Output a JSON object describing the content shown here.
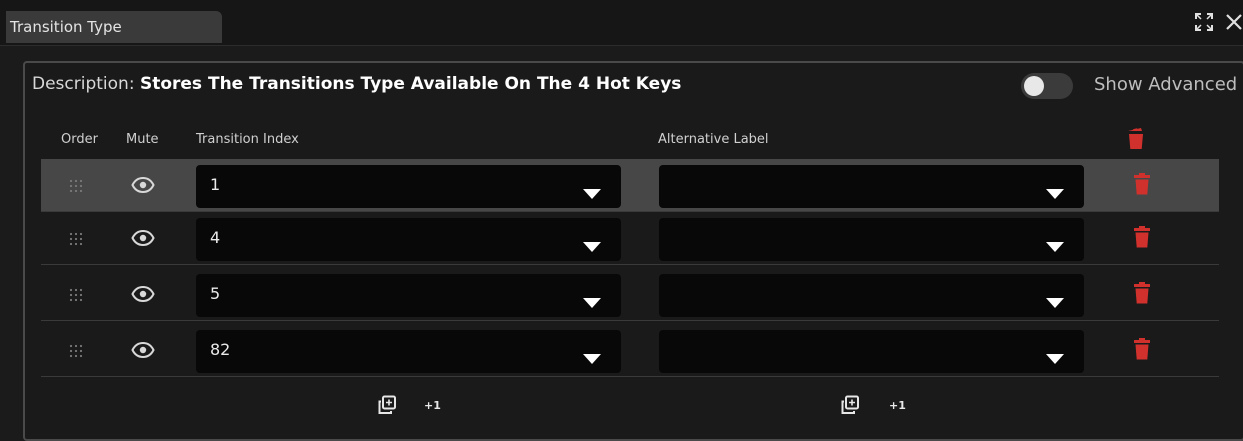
{
  "window": {
    "tab_title": "Transition Type"
  },
  "panel": {
    "description_label": "Description:",
    "description_text": "Stores The Transitions Type Available On The 4 Hot Keys",
    "show_advanced_label": "Show Advanced",
    "show_advanced_on": false
  },
  "columns": {
    "order": "Order",
    "mute": "Mute",
    "transition_index": "Transition Index",
    "alternative_label": "Alternative Label"
  },
  "rows": [
    {
      "transition_index": "1",
      "alternative_label": "",
      "selected": true
    },
    {
      "transition_index": "4",
      "alternative_label": "",
      "selected": false
    },
    {
      "transition_index": "5",
      "alternative_label": "",
      "selected": false
    },
    {
      "transition_index": "82",
      "alternative_label": "",
      "selected": false
    }
  ],
  "footer": {
    "add_one_label": "+1"
  },
  "colors": {
    "delete_red": "#d0312d",
    "selected_row": "#474747"
  },
  "icons": [
    "expand-icon",
    "close-icon",
    "drag-handle-icon",
    "eye-icon",
    "caret-down-icon",
    "trash-icon",
    "trash-open-icon",
    "duplicate-icon"
  ]
}
